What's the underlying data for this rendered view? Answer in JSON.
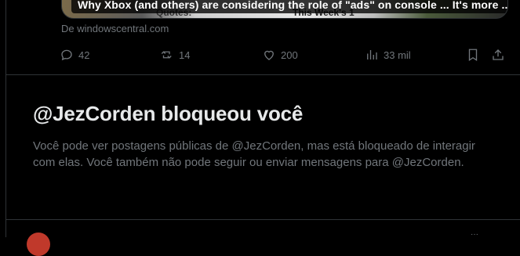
{
  "card": {
    "title": "Why Xbox (and others) are considering the role of \"ads\" on console ... It's more ...",
    "bg_text_1": "Quotes:",
    "bg_text_2": "This Week's 1"
  },
  "source_text": "De windowscentral.com",
  "actions": {
    "replies": "42",
    "reposts": "14",
    "likes": "200",
    "views": "33 mil"
  },
  "blocked": {
    "title": "@JezCorden bloqueou você",
    "message": "Você pode ver postagens públicas de @JezCorden, mas está bloqueado de interagir com elas. Você também não pode seguir ou enviar mensagens para @JezCorden."
  },
  "icons": [
    "reply-icon",
    "repost-icon",
    "like-icon",
    "views-icon",
    "bookmark-icon",
    "share-icon",
    "more-icon"
  ],
  "colors": {
    "background": "#000000",
    "text_primary": "#e7e9ea",
    "text_secondary": "#71767b",
    "border": "#2f3336"
  }
}
